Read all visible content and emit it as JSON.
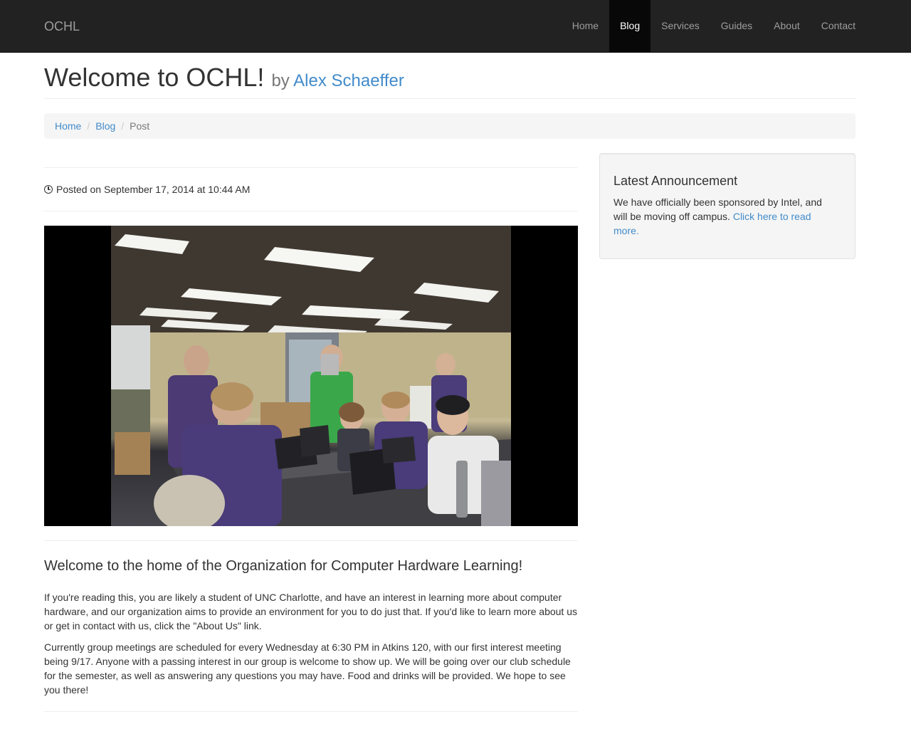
{
  "navbar": {
    "brand": "OCHL",
    "items": [
      {
        "label": "Home",
        "active": false
      },
      {
        "label": "Blog",
        "active": true
      },
      {
        "label": "Services",
        "active": false
      },
      {
        "label": "Guides",
        "active": false
      },
      {
        "label": "About",
        "active": false
      },
      {
        "label": "Contact",
        "active": false
      }
    ]
  },
  "header": {
    "title": "Welcome to OCHL!",
    "by": "by",
    "author": "Alex Schaeffer"
  },
  "breadcrumb": {
    "items": [
      "Home",
      "Blog",
      "Post"
    ],
    "separator": "/"
  },
  "post": {
    "posted": "Posted on September 17, 2014 at 10:44 AM",
    "image_alt": "Club members gathered around laptops in a classroom",
    "heading": "Welcome to the home of the Organization for Computer Hardware Learning!",
    "paragraphs": [
      "If you're reading this, you are likely a student of UNC Charlotte, and have an interest in learning more about computer hardware, and our organization aims to provide an environment for you to do just that. If you'd like to learn more about us or get in contact with us, click the \"About Us\" link.",
      "Currently group meetings are scheduled for every Wednesday at 6:30 PM in Atkins 120, with our first interest meeting being 9/17. Anyone with a passing interest in our group is welcome to show up. We will be going over our club schedule for the semester, as well as answering any questions you may have. Food and drinks will be provided. We hope to see you there!"
    ]
  },
  "sidebar": {
    "title": "Latest Announcement",
    "text": "We have officially been sponsored by Intel, and will be moving off campus. ",
    "link": "Click here to read more."
  },
  "colors": {
    "navbar_bg": "#222222",
    "nav_active_bg": "#080808",
    "link": "#428bca",
    "text": "#333333",
    "muted": "#777777",
    "well_bg": "#f5f5f5"
  }
}
